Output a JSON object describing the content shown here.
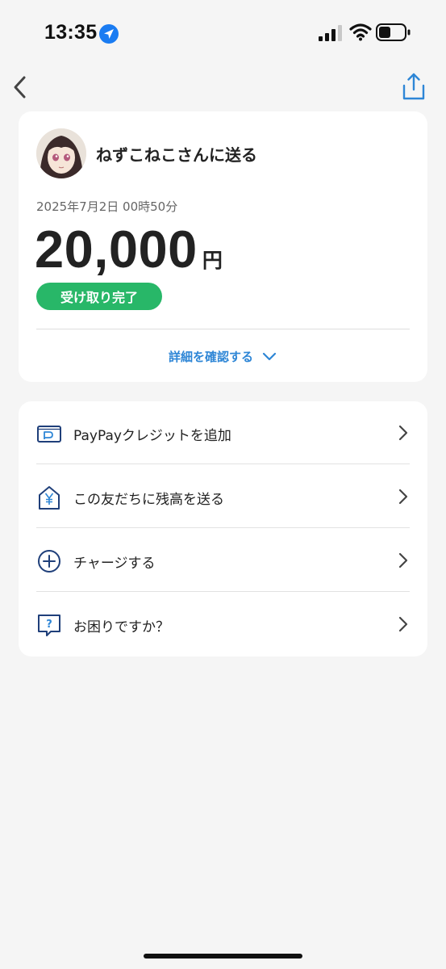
{
  "status_bar": {
    "time": "13:35",
    "icons": [
      "location-arrow-icon",
      "signal-icon",
      "wifi-icon",
      "battery-icon"
    ]
  },
  "nav": {
    "back_icon": "chevron-left-icon",
    "share_icon": "share-icon"
  },
  "summary": {
    "recipient_title": "ねずこねこさんに送る",
    "timestamp": "2025年7月2日 00時50分",
    "amount": "20,000",
    "currency": "円",
    "status": "受け取り完了",
    "details_label": "詳細を確認する"
  },
  "actions": [
    {
      "label": "PayPayクレジットを追加",
      "icon": "paypay-card-icon"
    },
    {
      "label": "この友だちに残高を送る",
      "icon": "yen-house-icon"
    },
    {
      "label": "チャージする",
      "icon": "plus-circle-icon"
    },
    {
      "label": "お困りですか？",
      "icon": "help-chat-icon"
    }
  ],
  "colors": {
    "accent_blue": "#2e86d6",
    "icon_navy": "#1f3f7a",
    "status_green": "#28b768",
    "background": "#f5f5f5"
  }
}
